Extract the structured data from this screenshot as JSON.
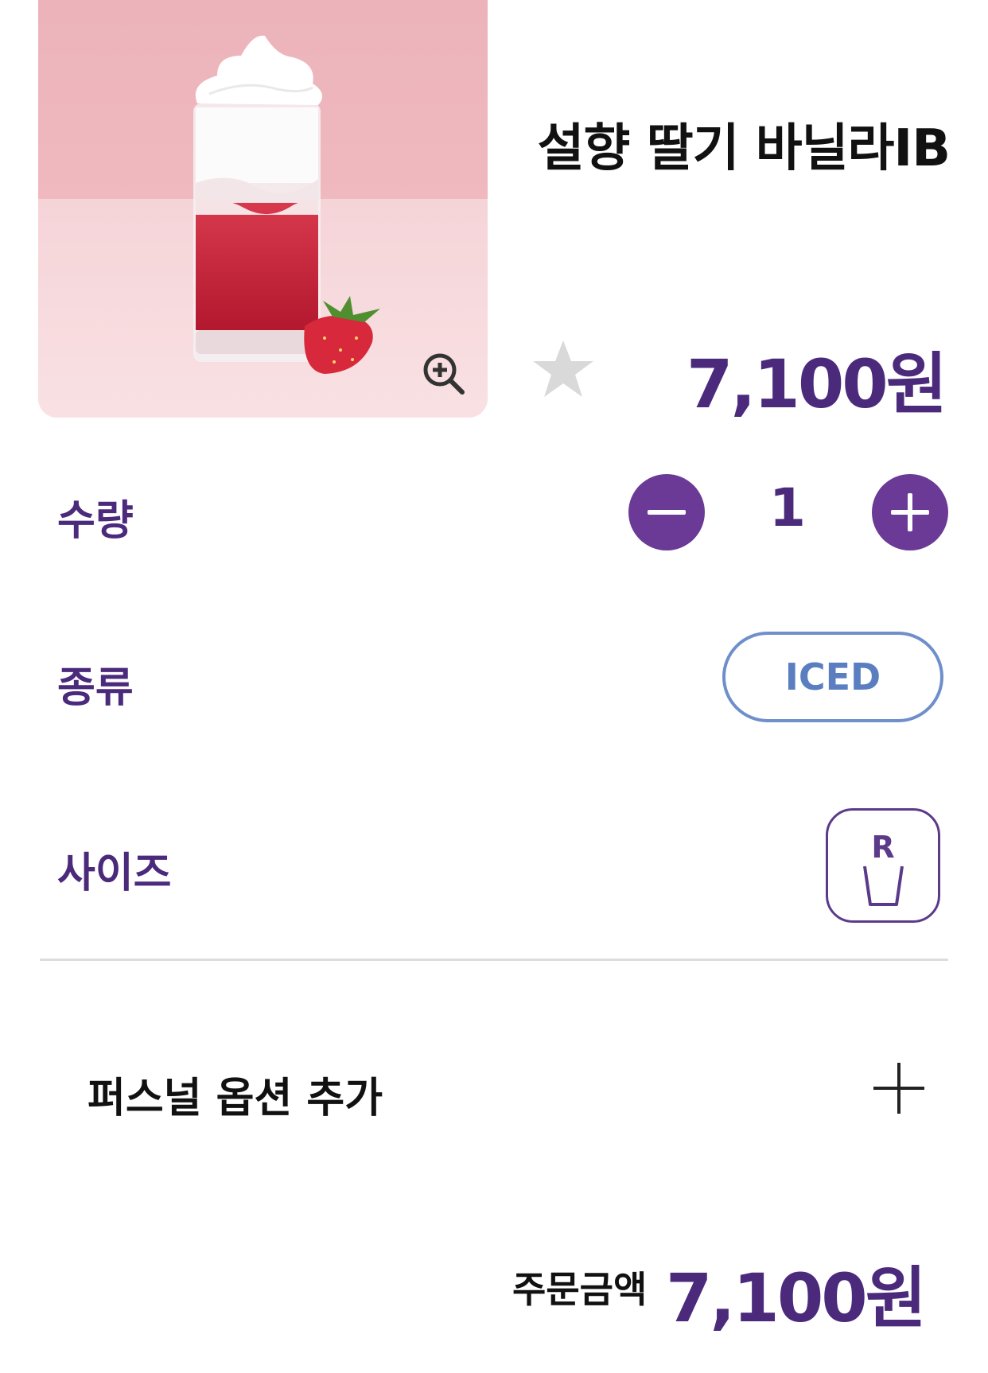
{
  "product": {
    "name": "설향 딸기 바닐라IB",
    "price": "7,100원",
    "image_alt": "strawberry-vanilla-drink-photo"
  },
  "icons": {
    "zoom": "zoom-in-icon",
    "favorite": "star-icon",
    "minus": "minus-icon",
    "plus": "plus-icon",
    "size": "cup-icon",
    "personal_add": "plus-icon"
  },
  "options": {
    "quantity_label": "수량",
    "quantity_value": "1",
    "type_label": "종류",
    "type_value": "ICED",
    "size_label": "사이즈",
    "size_value": "R"
  },
  "personal_option": {
    "label": "퍼스널 옵션 추가"
  },
  "order": {
    "total_label": "주문금액",
    "total_price": "7,100원"
  },
  "colors": {
    "accent": "#4b2a7c",
    "button": "#6a3a96",
    "type_border": "#6f8fcb",
    "favorite_inactive": "#d9d9d9"
  }
}
